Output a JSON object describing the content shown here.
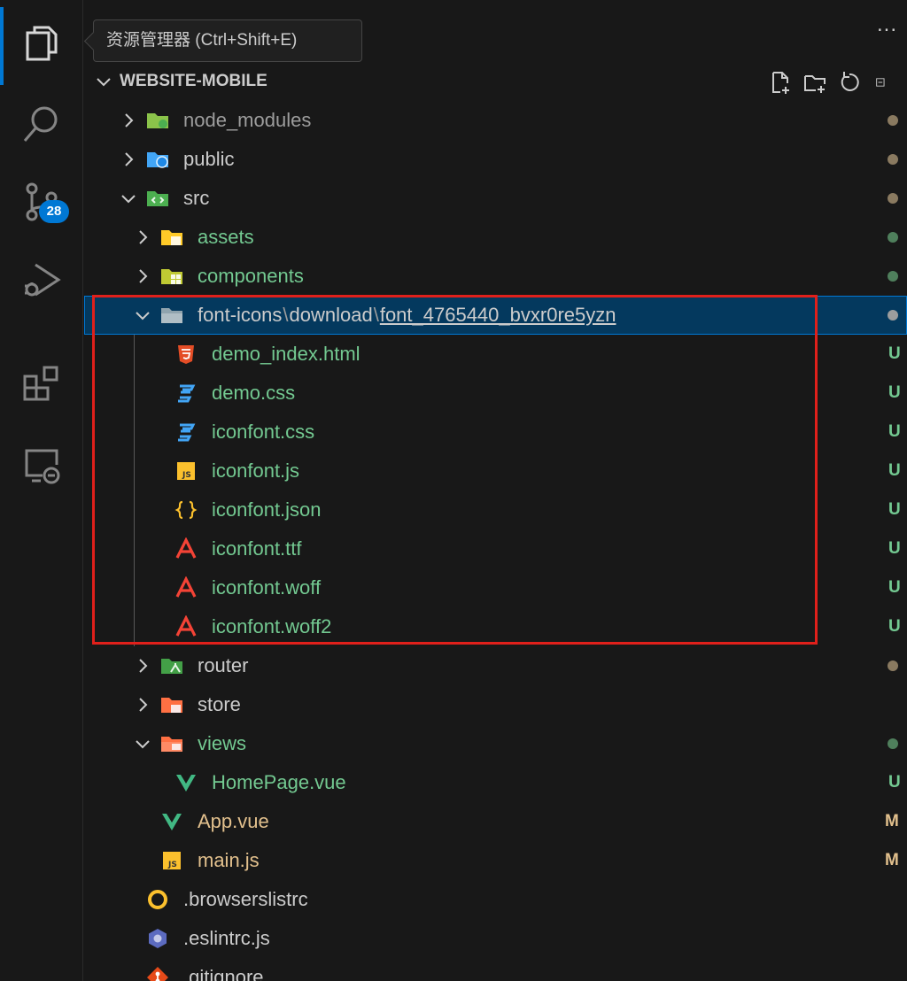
{
  "tooltip": "资源管理器 (Ctrl+Shift+E)",
  "more_actions": "...",
  "activity_bar": {
    "items": [
      {
        "name": "explorer",
        "icon": "files-icon",
        "active": true
      },
      {
        "name": "search",
        "icon": "search-icon"
      },
      {
        "name": "source-control",
        "icon": "source-control-icon",
        "badge": "28"
      },
      {
        "name": "run-debug",
        "icon": "run-debug-icon"
      },
      {
        "name": "extensions",
        "icon": "extensions-icon"
      },
      {
        "name": "remote-explorer",
        "icon": "remote-explorer-icon"
      }
    ]
  },
  "explorer": {
    "section_title": "WEBSITE-MOBILE",
    "actions": [
      "new-file-icon",
      "new-folder-icon",
      "refresh-icon",
      "collapse-icon"
    ],
    "tree": [
      {
        "label": "node_modules",
        "depth": 1,
        "kind": "folder",
        "expanded": false,
        "icon": "folder-node-icon",
        "color": "muted",
        "status": "dot"
      },
      {
        "label": "public",
        "depth": 1,
        "kind": "folder",
        "expanded": false,
        "icon": "folder-public-icon",
        "color": "plain",
        "status": "dot"
      },
      {
        "label": "src",
        "depth": 1,
        "kind": "folder",
        "expanded": true,
        "icon": "folder-src-icon",
        "color": "plain",
        "status": "dot"
      },
      {
        "label": "assets",
        "depth": 2,
        "kind": "folder",
        "expanded": false,
        "icon": "folder-assets-icon",
        "color": "untracked",
        "status": "dot-green"
      },
      {
        "label": "components",
        "depth": 2,
        "kind": "folder",
        "expanded": false,
        "icon": "folder-components-icon",
        "color": "untracked",
        "status": "dot-green"
      },
      {
        "label_parts": [
          "font-icons",
          "download",
          "font_4765440_bvxr0re5yzn"
        ],
        "depth": 2,
        "kind": "folder",
        "expanded": true,
        "icon": "folder-icon",
        "color": "plain",
        "status": "dot-light",
        "selected": true
      },
      {
        "label": "demo_index.html",
        "depth": 3,
        "kind": "file",
        "icon": "html-icon",
        "color": "untracked",
        "status": "U"
      },
      {
        "label": "demo.css",
        "depth": 3,
        "kind": "file",
        "icon": "css-icon",
        "color": "untracked",
        "status": "U"
      },
      {
        "label": "iconfont.css",
        "depth": 3,
        "kind": "file",
        "icon": "css-icon",
        "color": "untracked",
        "status": "U"
      },
      {
        "label": "iconfont.js",
        "depth": 3,
        "kind": "file",
        "icon": "js-icon",
        "color": "untracked",
        "status": "U"
      },
      {
        "label": "iconfont.json",
        "depth": 3,
        "kind": "file",
        "icon": "json-icon",
        "color": "untracked",
        "status": "U"
      },
      {
        "label": "iconfont.ttf",
        "depth": 3,
        "kind": "file",
        "icon": "font-icon",
        "color": "untracked",
        "status": "U"
      },
      {
        "label": "iconfont.woff",
        "depth": 3,
        "kind": "file",
        "icon": "font-icon",
        "color": "untracked",
        "status": "U"
      },
      {
        "label": "iconfont.woff2",
        "depth": 3,
        "kind": "file",
        "icon": "font-icon",
        "color": "untracked",
        "status": "U"
      },
      {
        "label": "router",
        "depth": 2,
        "kind": "folder",
        "expanded": false,
        "icon": "folder-router-icon",
        "color": "plain",
        "status": "dot"
      },
      {
        "label": "store",
        "depth": 2,
        "kind": "folder",
        "expanded": false,
        "icon": "folder-store-icon",
        "color": "plain",
        "status": ""
      },
      {
        "label": "views",
        "depth": 2,
        "kind": "folder",
        "expanded": true,
        "icon": "folder-views-icon",
        "color": "untracked",
        "status": "dot-green"
      },
      {
        "label": "HomePage.vue",
        "depth": 3,
        "kind": "file",
        "icon": "vue-icon",
        "color": "untracked",
        "status": "U"
      },
      {
        "label": "App.vue",
        "depth": 2,
        "kind": "file",
        "icon": "vue-icon",
        "color": "modified",
        "status": "M"
      },
      {
        "label": "main.js",
        "depth": 2,
        "kind": "file",
        "icon": "js-icon",
        "color": "modified",
        "status": "M"
      },
      {
        "label": ".browserslistrc",
        "depth": 1,
        "kind": "file",
        "icon": "browserslist-icon",
        "color": "plain",
        "status": ""
      },
      {
        "label": ".eslintrc.js",
        "depth": 1,
        "kind": "file",
        "icon": "eslint-icon",
        "color": "plain",
        "status": ""
      },
      {
        "label": ".gitignore",
        "depth": 1,
        "kind": "file",
        "icon": "git-icon",
        "color": "plain",
        "status": ""
      }
    ]
  },
  "colors": {
    "accent": "#0078d4",
    "untracked": "#73c991",
    "modified": "#e2c08d",
    "annotation_box": "#e0201b"
  }
}
